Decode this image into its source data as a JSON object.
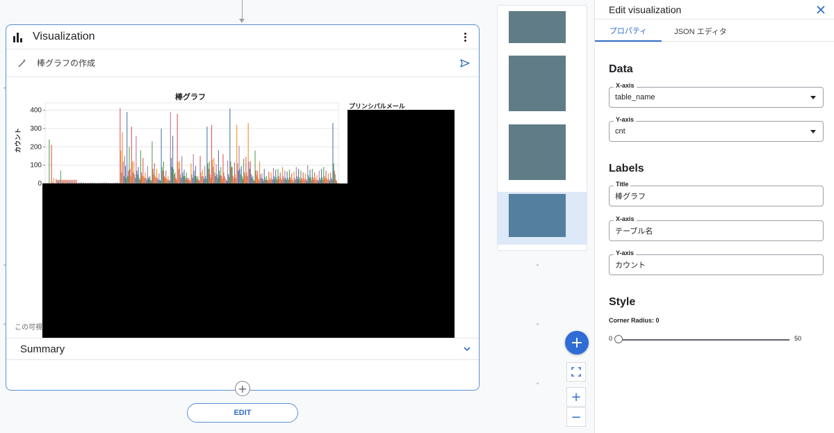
{
  "card": {
    "title": "Visualization",
    "prompt": "棒グラフの作成",
    "notice": "この可視",
    "summary_label": "Summary",
    "edit_label": "EDIT",
    "add_symbol": "+"
  },
  "chart_data": {
    "type": "bar",
    "title": "棒グラフ",
    "ylabel": "カウント",
    "xlabel": "",
    "ylim": [
      0,
      440
    ],
    "y_ticks": [
      0,
      100,
      200,
      300,
      400
    ],
    "legend_title": "プリンシパルメール",
    "colors": [
      "#4e79a7",
      "#59a14f",
      "#e15759",
      "#f28e2b",
      "#b07aa1"
    ],
    "series_values": [
      [
        0,
        240,
        210,
        30,
        25,
        15,
        70,
        10,
        15,
        12,
        8,
        5,
        4,
        5,
        6,
        7,
        6,
        5,
        4,
        6,
        5,
        4,
        3,
        5,
        4,
        6,
        5,
        4,
        3,
        4,
        5,
        6,
        410,
        280,
        150,
        390,
        200,
        310,
        120,
        260,
        90,
        180,
        140,
        60,
        95,
        40,
        230,
        110,
        80,
        55,
        300,
        120,
        70,
        40,
        390,
        260,
        60,
        380,
        120,
        150,
        75,
        60,
        30,
        110,
        160,
        95,
        40,
        150,
        75,
        95,
        310,
        120,
        320,
        140,
        105,
        180,
        90,
        160,
        30,
        125,
        410,
        90,
        115,
        320,
        205,
        95,
        135,
        145,
        330,
        120,
        40,
        180,
        70,
        120,
        55,
        80,
        40,
        65,
        60,
        85,
        75,
        80,
        60,
        90,
        70,
        65,
        75,
        55,
        65,
        90,
        80,
        70,
        60,
        55,
        100,
        75,
        80,
        60,
        45,
        70,
        80,
        90,
        70,
        55,
        60,
        330,
        50
      ],
      [
        0,
        0,
        10,
        0,
        0,
        0,
        0,
        0,
        0,
        0,
        0,
        0,
        0,
        0,
        0,
        0,
        0,
        0,
        0,
        0,
        0,
        0,
        0,
        0,
        0,
        0,
        0,
        0,
        0,
        0,
        0,
        0,
        180,
        120,
        95,
        40,
        80,
        120,
        50,
        70,
        30,
        60,
        40,
        30,
        35,
        20,
        80,
        40,
        30,
        20,
        90,
        40,
        30,
        20,
        140,
        80,
        30,
        120,
        50,
        60,
        40,
        30,
        20,
        50,
        70,
        40,
        20,
        60,
        40,
        40,
        110,
        50,
        130,
        60,
        50,
        70,
        40,
        60,
        20,
        50,
        120,
        40,
        50,
        110,
        80,
        40,
        60,
        60,
        120,
        50,
        20,
        70,
        30,
        50,
        25,
        35,
        20,
        30,
        30,
        40,
        35,
        40,
        30,
        40,
        30,
        30,
        35,
        25,
        30,
        40,
        35,
        30,
        30,
        25,
        45,
        35,
        35,
        30,
        20,
        30,
        35,
        40,
        30,
        25,
        30,
        110,
        20
      ],
      [
        0,
        0,
        0,
        0,
        0,
        0,
        0,
        0,
        0,
        0,
        0,
        0,
        0,
        0,
        0,
        0,
        0,
        0,
        0,
        0,
        0,
        0,
        0,
        0,
        0,
        0,
        0,
        0,
        0,
        0,
        0,
        0,
        60,
        40,
        30,
        70,
        40,
        60,
        30,
        50,
        20,
        40,
        30,
        20,
        25,
        15,
        50,
        30,
        20,
        15,
        70,
        30,
        20,
        15,
        90,
        50,
        20,
        80,
        30,
        40,
        25,
        20,
        15,
        30,
        40,
        25,
        15,
        40,
        25,
        25,
        80,
        30,
        90,
        40,
        30,
        45,
        25,
        40,
        15,
        35,
        90,
        25,
        30,
        70,
        50,
        25,
        40,
        40,
        80,
        30,
        15,
        45,
        20,
        30,
        15,
        20,
        15,
        20,
        20,
        25,
        20,
        25,
        20,
        25,
        20,
        20,
        20,
        15,
        20,
        25,
        20,
        20,
        20,
        15,
        30,
        20,
        20,
        20,
        15,
        20,
        20,
        25,
        20,
        15,
        20,
        70,
        15
      ]
    ],
    "salmon_patch_value": 20
  },
  "thumbnails": {
    "count": 4,
    "selected_index": 3
  },
  "controls": {
    "fab_symbol": "+",
    "zoom_in": "+",
    "zoom_out": "−"
  },
  "panel": {
    "title": "Edit visualization",
    "tabs": [
      "プロパティ",
      "JSON エディタ"
    ],
    "active_tab": 0,
    "data_section": "Data",
    "x_axis_label": "X-axis",
    "x_axis_value": "table_name",
    "y_axis_label": "Y-axis",
    "y_axis_value": "cnt",
    "labels_section": "Labels",
    "title_label": "Title",
    "title_value": "棒グラフ",
    "labels_x_label": "X-axis",
    "labels_x_value": "テーブル名",
    "labels_y_label": "Y-axis",
    "labels_y_value": "カウント",
    "style_section": "Style",
    "corner_radius_label": "Corner Radius: 0",
    "slider_min": "0",
    "slider_max": "50",
    "slider_value": 0
  }
}
